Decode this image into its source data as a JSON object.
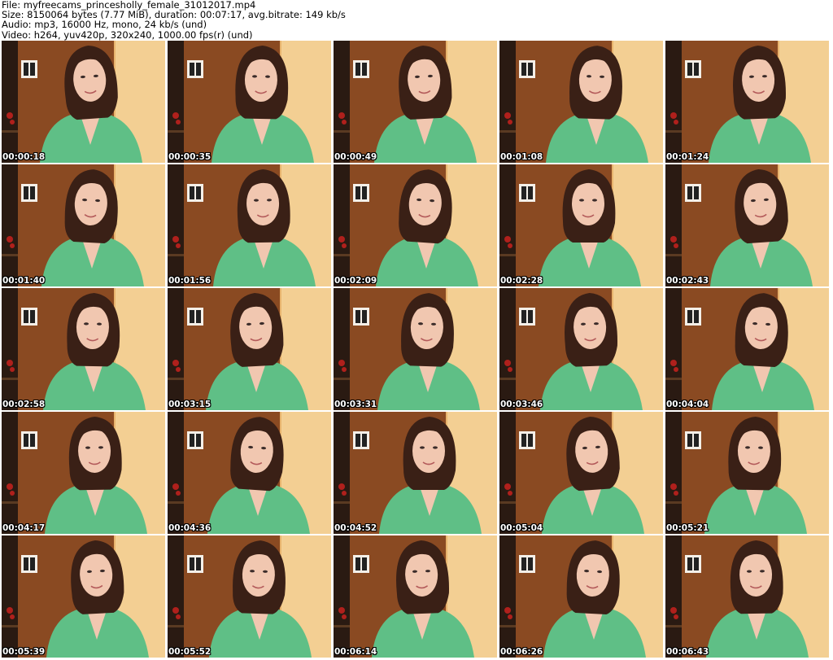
{
  "header": {
    "file_line": "File: myfreecams_princesholly_female_31012017.mp4",
    "size_line": "Size: 8150064 bytes (7.77 MiB), duration: 00:07:17, avg.bitrate: 149 kb/s",
    "audio_line": "Audio: mp3, 16000 Hz, mono, 24 kb/s (und)",
    "video_line": "Video: h264, yuv420p, 320x240, 1000.00 fps(r) (und)"
  },
  "thumbnails": [
    {
      "timestamp": "00:00:18"
    },
    {
      "timestamp": "00:00:35"
    },
    {
      "timestamp": "00:00:49"
    },
    {
      "timestamp": "00:01:08"
    },
    {
      "timestamp": "00:01:24"
    },
    {
      "timestamp": "00:01:40"
    },
    {
      "timestamp": "00:01:56"
    },
    {
      "timestamp": "00:02:09"
    },
    {
      "timestamp": "00:02:28"
    },
    {
      "timestamp": "00:02:43"
    },
    {
      "timestamp": "00:02:58"
    },
    {
      "timestamp": "00:03:15"
    },
    {
      "timestamp": "00:03:31"
    },
    {
      "timestamp": "00:03:46"
    },
    {
      "timestamp": "00:04:04"
    },
    {
      "timestamp": "00:04:17"
    },
    {
      "timestamp": "00:04:36"
    },
    {
      "timestamp": "00:04:52"
    },
    {
      "timestamp": "00:05:04"
    },
    {
      "timestamp": "00:05:21"
    },
    {
      "timestamp": "00:05:39"
    },
    {
      "timestamp": "00:05:52"
    },
    {
      "timestamp": "00:06:14"
    },
    {
      "timestamp": "00:06:26"
    },
    {
      "timestamp": "00:06:43"
    }
  ],
  "colors": {
    "wall": "#e8b46e",
    "door": "#8a4a22",
    "shelf": "#2a1a12",
    "sweater": "#5fbf86",
    "hair": "#3a2016",
    "skin": "#f1c7b0"
  }
}
